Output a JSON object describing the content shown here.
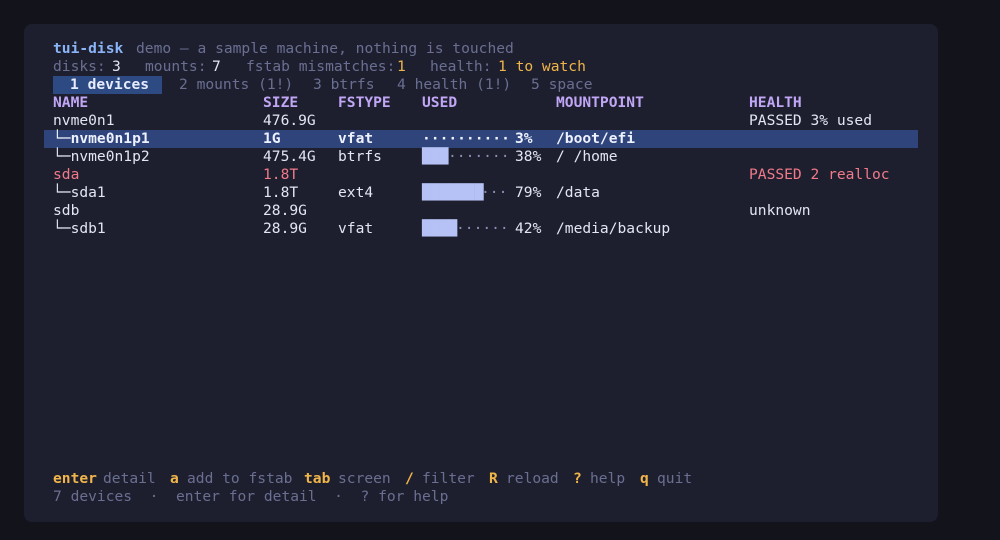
{
  "header": {
    "app": "tui-disk",
    "subtitle": "demo — a sample machine, nothing is touched"
  },
  "stats": {
    "disks_label": "disks:",
    "disks_value": "3",
    "mounts_label": "mounts:",
    "mounts_value": "7",
    "fstab_label": "fstab mismatches:",
    "fstab_value": "1",
    "health_label": "health:",
    "health_value": "1 to watch"
  },
  "tabs": [
    {
      "label": "1 devices"
    },
    {
      "label": "2 mounts (1!)"
    },
    {
      "label": "3 btrfs"
    },
    {
      "label": "4 health (1!)"
    },
    {
      "label": "5 space"
    }
  ],
  "table": {
    "columns": [
      "NAME",
      "SIZE",
      "FSTYPE",
      "USED",
      "MOUNTPOINT",
      "HEALTH"
    ],
    "rows": [
      {
        "name": "nvme0n1",
        "size": "476.9G",
        "fstype": "",
        "bar": "",
        "bar_empty": "",
        "pct": "",
        "mount": "",
        "health": "PASSED 3% used"
      },
      {
        "name": "└─nvme0n1p1",
        "size": "1G",
        "fstype": "vfat",
        "bar": "",
        "bar_empty": "··········",
        "pct": "3%",
        "mount": "/boot/efi",
        "health": ""
      },
      {
        "name": "└─nvme0n1p2",
        "size": "475.4G",
        "fstype": "btrfs",
        "bar": "███",
        "bar_empty": "·······",
        "pct": "38%",
        "mount": "/ /home",
        "health": ""
      },
      {
        "name": "sda",
        "size": "1.8T",
        "fstype": "",
        "bar": "",
        "bar_empty": "",
        "pct": "",
        "mount": "",
        "health": "PASSED 2 realloc"
      },
      {
        "name": "└─sda1",
        "size": "1.8T",
        "fstype": "ext4",
        "bar": "███████",
        "bar_empty": "···",
        "pct": "79%",
        "mount": "/data",
        "health": ""
      },
      {
        "name": "sdb",
        "size": "28.9G",
        "fstype": "",
        "bar": "",
        "bar_empty": "",
        "pct": "",
        "mount": "",
        "health": "unknown"
      },
      {
        "name": "└─sdb1",
        "size": "28.9G",
        "fstype": "vfat",
        "bar": "████",
        "bar_empty": "······",
        "pct": "42%",
        "mount": "/media/backup",
        "health": ""
      }
    ]
  },
  "used_percent": {
    "nvme0n1p1": 3,
    "nvme0n1p2": 38,
    "sda1": 79,
    "sdb1": 42
  },
  "selected_row": "└─nvme0n1p1",
  "keys": [
    {
      "key": "enter",
      "desc": "detail"
    },
    {
      "key": "a",
      "desc": "add to fstab"
    },
    {
      "key": "tab",
      "desc": "screen"
    },
    {
      "key": "/",
      "desc": "filter"
    },
    {
      "key": "R",
      "desc": "reload"
    },
    {
      "key": "?",
      "desc": "help"
    },
    {
      "key": "q",
      "desc": "quit"
    }
  ],
  "status": "7 devices  ·  enter for detail  ·  ? for help",
  "colors": {
    "background": "#1e1f2e",
    "selection": "#2e447b",
    "accent": "#c0a6f5",
    "warning": "#f0b54a",
    "error": "#f07a8a"
  }
}
